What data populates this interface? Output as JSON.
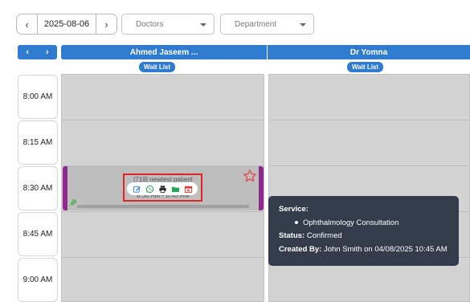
{
  "toolbar": {
    "prev_glyph": "‹",
    "next_glyph": "›",
    "date": "2025-08-06",
    "doctors_placeholder": "Doctors",
    "department_placeholder": "Department"
  },
  "header": {
    "nav_prev": "‹",
    "nav_next": "›",
    "columns": [
      {
        "name": "Ahmed Jaseem ...",
        "wait_list": "Wait List"
      },
      {
        "name": "Dr Yomna",
        "wait_list": "Wait List"
      }
    ]
  },
  "time_slots": [
    "8:00 AM",
    "8:15 AM",
    "8:30 AM",
    "8:45 AM",
    "9:00 AM"
  ],
  "appointment": {
    "title": "[719] newtest patient",
    "time_range": "8:30 AM - 8:45 AM",
    "status_color": "#8e2a8e",
    "actions": [
      "edit-icon",
      "whatsapp-icon",
      "print-icon",
      "folder-icon",
      "calendar-icon"
    ]
  },
  "tooltip": {
    "service_label": "Service:",
    "service_item": "Ophthalmology Consultation",
    "status_label": "Status:",
    "status_value": "Confirmed",
    "created_label": "Created By:",
    "created_value": "John Smith on 04/08/2025 10:45 AM"
  },
  "colors": {
    "accent": "#2f7bd0",
    "grid": "#d3d3d3",
    "tooltip_bg": "#343c4b",
    "highlight_box": "#e12525"
  }
}
